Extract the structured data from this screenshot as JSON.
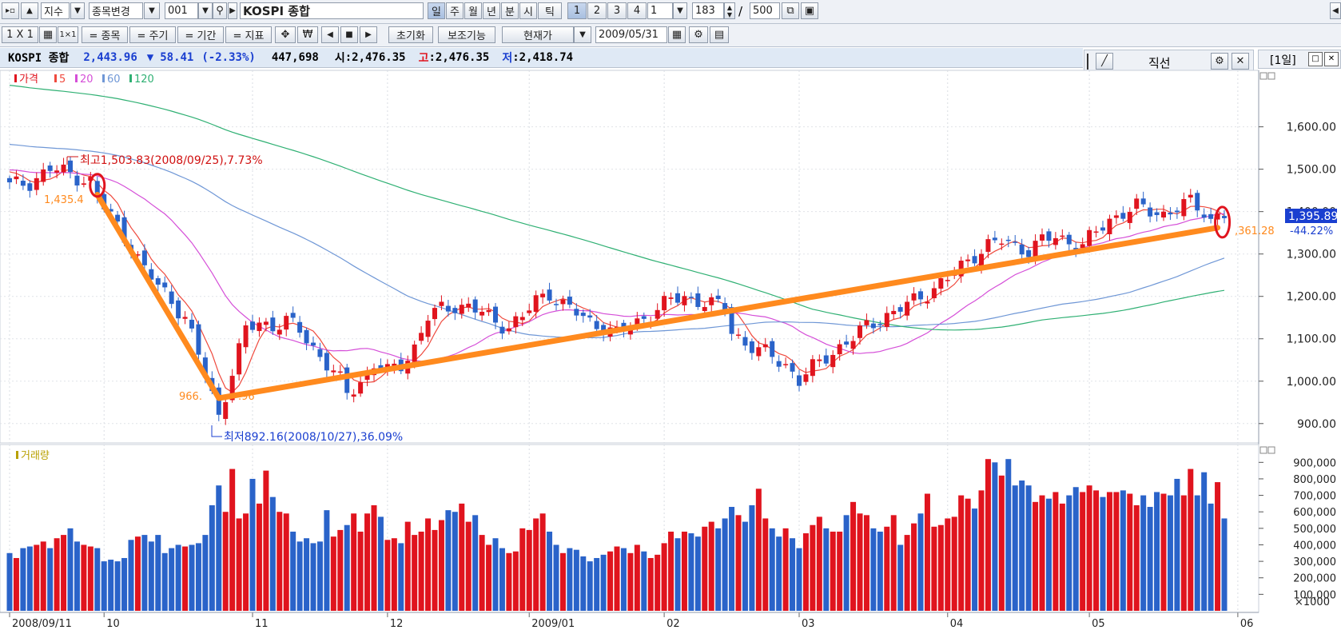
{
  "toolbar1": {
    "market": "지수",
    "change_stock": "종목변경",
    "code": "001",
    "name": "KOSPI 종합",
    "periods": [
      "일",
      "주",
      "월",
      "년",
      "분",
      "시",
      "틱"
    ],
    "numbers": [
      "1",
      "2",
      "3",
      "4"
    ],
    "interval": "1",
    "count": "183",
    "separator": "/",
    "max": "500"
  },
  "toolbar2": {
    "grid": "1 X 1",
    "tab_stock": "= 종목",
    "tab_cycle": "= 주기",
    "tab_period": "= 기간",
    "tab_indicator": "= 지표",
    "reset": "초기화",
    "aux": "보조기능",
    "price_type": "현재가",
    "date": "2009/05/31"
  },
  "info_bar": {
    "name": "KOSPI 종합",
    "price": "2,443.96",
    "change_arrow": "▼",
    "change": "58.41",
    "change_pct": "(-2.33%)",
    "volume": "447,698",
    "open_label": "시",
    "open": ":2,476.35",
    "high_label": "고",
    "high": ":2,476.35",
    "low_label": "저",
    "low": ":2,418.74"
  },
  "line_tool": {
    "title": "직선"
  },
  "period_label": "[1일]",
  "colors": {
    "up": "#e0141e",
    "down": "#2a63c9",
    "ma5": "#ef4a3e",
    "ma20": "#d54fd8",
    "ma60": "#6f97d6",
    "ma120": "#2fb073",
    "trend": "#ff8a1e"
  },
  "chart_data": [
    {
      "type": "candlestick",
      "legend": [
        "가격",
        "5",
        "20",
        "60",
        "120"
      ],
      "ylim": [
        860,
        1720
      ],
      "yticks": [
        900,
        1000,
        1100,
        1200,
        1300,
        1400,
        1500,
        1600
      ],
      "ytick_labels": [
        "900.00",
        "1,000.00",
        "1,100.00",
        "1,200.00",
        "1,300.00",
        "1,400.00",
        "1,500.00",
        "1,600.00"
      ],
      "x_labels": [
        "2008/09/11",
        "10",
        "11",
        "12",
        "2009/01",
        "02",
        "03",
        "04",
        "05",
        "06"
      ],
      "x_label_index": [
        0,
        14,
        36,
        56,
        77,
        97,
        117,
        139,
        160,
        182
      ],
      "annotations": {
        "high": "최고1,503.83(2008/09/25),7.73%",
        "low": "최저892.16(2008/10/27),36.09%",
        "current_price": "1,395.89",
        "current_pct": "-44.22%",
        "trend_start": "1,435.4",
        "trend_valley": "966.",
        "trend_valley_suffix": ".96",
        "trend_end": ",361.28"
      },
      "trendline": [
        [
          13,
          1440
        ],
        [
          31,
          960
        ],
        [
          179,
          1362
        ]
      ],
      "key_points": [
        [
          0,
          1460
        ],
        [
          3,
          1470
        ],
        [
          6,
          1500
        ],
        [
          9,
          1490
        ],
        [
          12,
          1470
        ],
        [
          13,
          1430
        ],
        [
          15,
          1390
        ],
        [
          18,
          1320
        ],
        [
          20,
          1260
        ],
        [
          23,
          1210
        ],
        [
          26,
          1150
        ],
        [
          28,
          1060
        ],
        [
          30,
          970
        ],
        [
          31,
          920
        ],
        [
          33,
          1020
        ],
        [
          35,
          1120
        ],
        [
          37,
          1140
        ],
        [
          39,
          1130
        ],
        [
          41,
          1140
        ],
        [
          43,
          1120
        ],
        [
          45,
          1080
        ],
        [
          47,
          1040
        ],
        [
          49,
          1000
        ],
        [
          50,
          970
        ],
        [
          52,
          1000
        ],
        [
          54,
          1040
        ],
        [
          56,
          1020
        ],
        [
          58,
          1040
        ],
        [
          60,
          1080
        ],
        [
          62,
          1150
        ],
        [
          64,
          1170
        ],
        [
          66,
          1180
        ],
        [
          68,
          1175
        ],
        [
          70,
          1160
        ],
        [
          72,
          1140
        ],
        [
          74,
          1130
        ],
        [
          76,
          1150
        ],
        [
          78,
          1190
        ],
        [
          80,
          1210
        ],
        [
          82,
          1180
        ],
        [
          84,
          1160
        ],
        [
          86,
          1140
        ],
        [
          88,
          1130
        ],
        [
          90,
          1110
        ],
        [
          92,
          1130
        ],
        [
          94,
          1150
        ],
        [
          96,
          1170
        ],
        [
          98,
          1190
        ],
        [
          100,
          1200
        ],
        [
          102,
          1190
        ],
        [
          104,
          1180
        ],
        [
          106,
          1175
        ],
        [
          107,
          1120
        ],
        [
          109,
          1090
        ],
        [
          111,
          1070
        ],
        [
          113,
          1060
        ],
        [
          115,
          1040
        ],
        [
          117,
          1000
        ],
        [
          119,
          1030
        ],
        [
          121,
          1060
        ],
        [
          123,
          1080
        ],
        [
          125,
          1100
        ],
        [
          127,
          1130
        ],
        [
          129,
          1150
        ],
        [
          131,
          1160
        ],
        [
          133,
          1180
        ],
        [
          135,
          1200
        ],
        [
          137,
          1220
        ],
        [
          139,
          1240
        ],
        [
          141,
          1270
        ],
        [
          143,
          1300
        ],
        [
          145,
          1320
        ],
        [
          147,
          1330
        ],
        [
          149,
          1320
        ],
        [
          151,
          1310
        ],
        [
          153,
          1330
        ],
        [
          155,
          1340
        ],
        [
          157,
          1330
        ],
        [
          159,
          1320
        ],
        [
          161,
          1350
        ],
        [
          163,
          1380
        ],
        [
          165,
          1400
        ],
        [
          167,
          1410
        ],
        [
          169,
          1400
        ],
        [
          171,
          1395
        ],
        [
          173,
          1410
        ],
        [
          175,
          1420
        ],
        [
          177,
          1400
        ],
        [
          178,
          1380
        ],
        [
          179,
          1396
        ]
      ]
    },
    {
      "type": "bar",
      "legend": [
        "거래량"
      ],
      "ylim": [
        0,
        950000
      ],
      "yticks": [
        100000,
        200000,
        300000,
        400000,
        500000,
        600000,
        700000,
        800000,
        900000
      ],
      "ytick_labels": [
        "100,000",
        "200,000",
        "300,000",
        "400,000",
        "500,000",
        "600,000",
        "700,000",
        "800,000",
        "900,000"
      ],
      "unit_label": "×1000",
      "values": [
        350000,
        320000,
        380000,
        390000,
        400000,
        420000,
        380000,
        440000,
        460000,
        500000,
        420000,
        400000,
        390000,
        380000,
        300000,
        310000,
        300000,
        320000,
        430000,
        450000,
        460000,
        420000,
        460000,
        350000,
        380000,
        400000,
        390000,
        400000,
        410000,
        460000,
        640000,
        760000,
        600000,
        860000,
        560000,
        590000,
        800000,
        650000,
        850000,
        690000,
        600000,
        590000,
        480000,
        420000,
        440000,
        410000,
        420000,
        610000,
        450000,
        490000,
        520000,
        590000,
        480000,
        590000,
        640000,
        570000,
        430000,
        440000,
        410000,
        540000,
        460000,
        480000,
        560000,
        490000,
        550000,
        610000,
        600000,
        650000,
        540000,
        580000,
        460000,
        400000,
        440000,
        380000,
        350000,
        360000,
        500000,
        490000,
        560000,
        590000,
        480000,
        400000,
        350000,
        380000,
        370000,
        330000,
        300000,
        320000,
        340000,
        360000,
        390000,
        380000,
        350000,
        400000,
        360000,
        320000,
        340000,
        410000,
        480000,
        440000,
        480000,
        470000,
        450000,
        510000,
        540000,
        500000,
        560000,
        630000,
        580000,
        540000,
        640000,
        740000,
        560000,
        500000,
        450000,
        500000,
        440000,
        380000,
        470000,
        520000,
        570000,
        500000,
        480000,
        480000,
        580000,
        660000,
        590000,
        580000,
        500000,
        480000,
        510000,
        580000,
        400000,
        460000,
        530000,
        590000,
        710000,
        510000,
        520000,
        560000,
        570000,
        700000,
        680000,
        620000,
        730000,
        920000,
        900000,
        820000,
        920000,
        760000,
        790000,
        760000,
        660000,
        700000,
        680000,
        720000,
        650000,
        700000,
        750000,
        720000,
        760000,
        730000,
        690000,
        720000,
        720000,
        730000,
        710000,
        640000,
        700000,
        630000,
        720000,
        710000,
        700000,
        800000,
        700000,
        860000,
        700000,
        840000,
        650000,
        780000,
        560000
      ],
      "colors": []
    }
  ]
}
